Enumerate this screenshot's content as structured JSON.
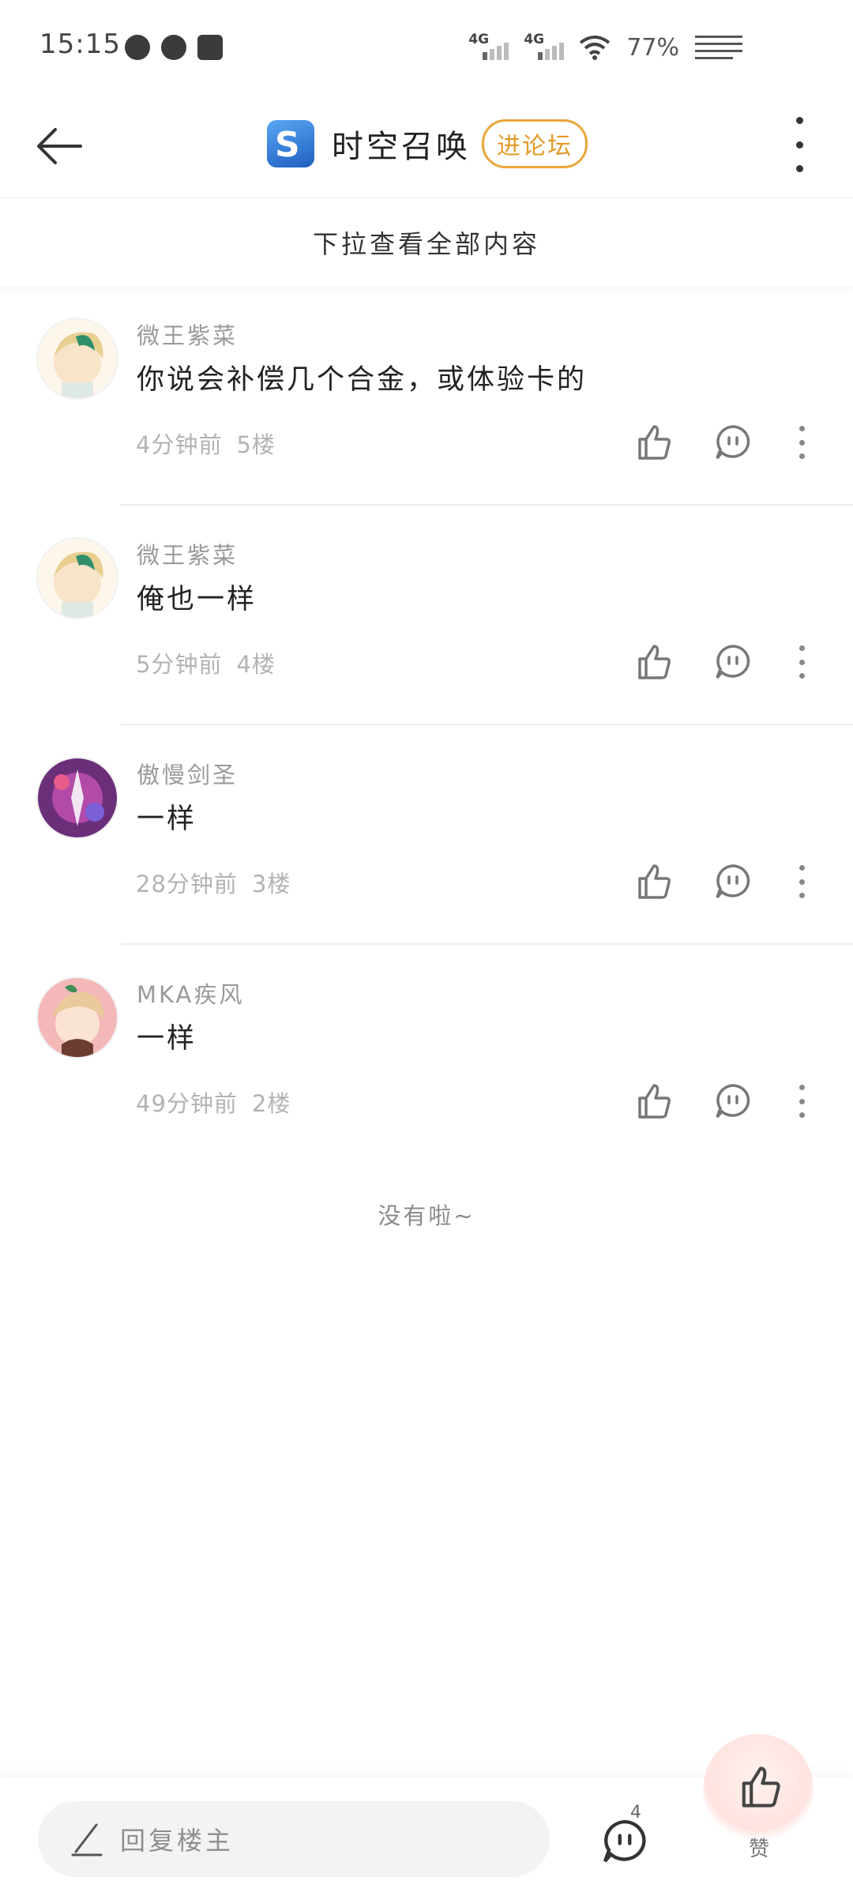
{
  "status_bar": {
    "time": "15:15",
    "network1": "4G",
    "network2": "4G",
    "battery": "77%"
  },
  "header": {
    "title": "时空召唤",
    "forum_button": "进论坛"
  },
  "pull_tip": "下拉查看全部内容",
  "replies": [
    {
      "user": "微王紫菜",
      "content": "你说会补偿几个合金，或体验卡的",
      "time": "4分钟前",
      "floor": "5楼"
    },
    {
      "user": "微王紫菜",
      "content": "俺也一样",
      "time": "5分钟前",
      "floor": "4楼"
    },
    {
      "user": "傲慢剑圣",
      "content": "一样",
      "time": "28分钟前",
      "floor": "3楼"
    },
    {
      "user": "MKA疾风",
      "content": "一样",
      "time": "49分钟前",
      "floor": "2楼"
    }
  ],
  "end_tip": "没有啦~",
  "bottom": {
    "reply_placeholder": "回复楼主",
    "comment_count": "4",
    "like_label": "赞"
  },
  "colors": {
    "accent": "#e39a2a",
    "text_muted": "#9a9a9a"
  }
}
